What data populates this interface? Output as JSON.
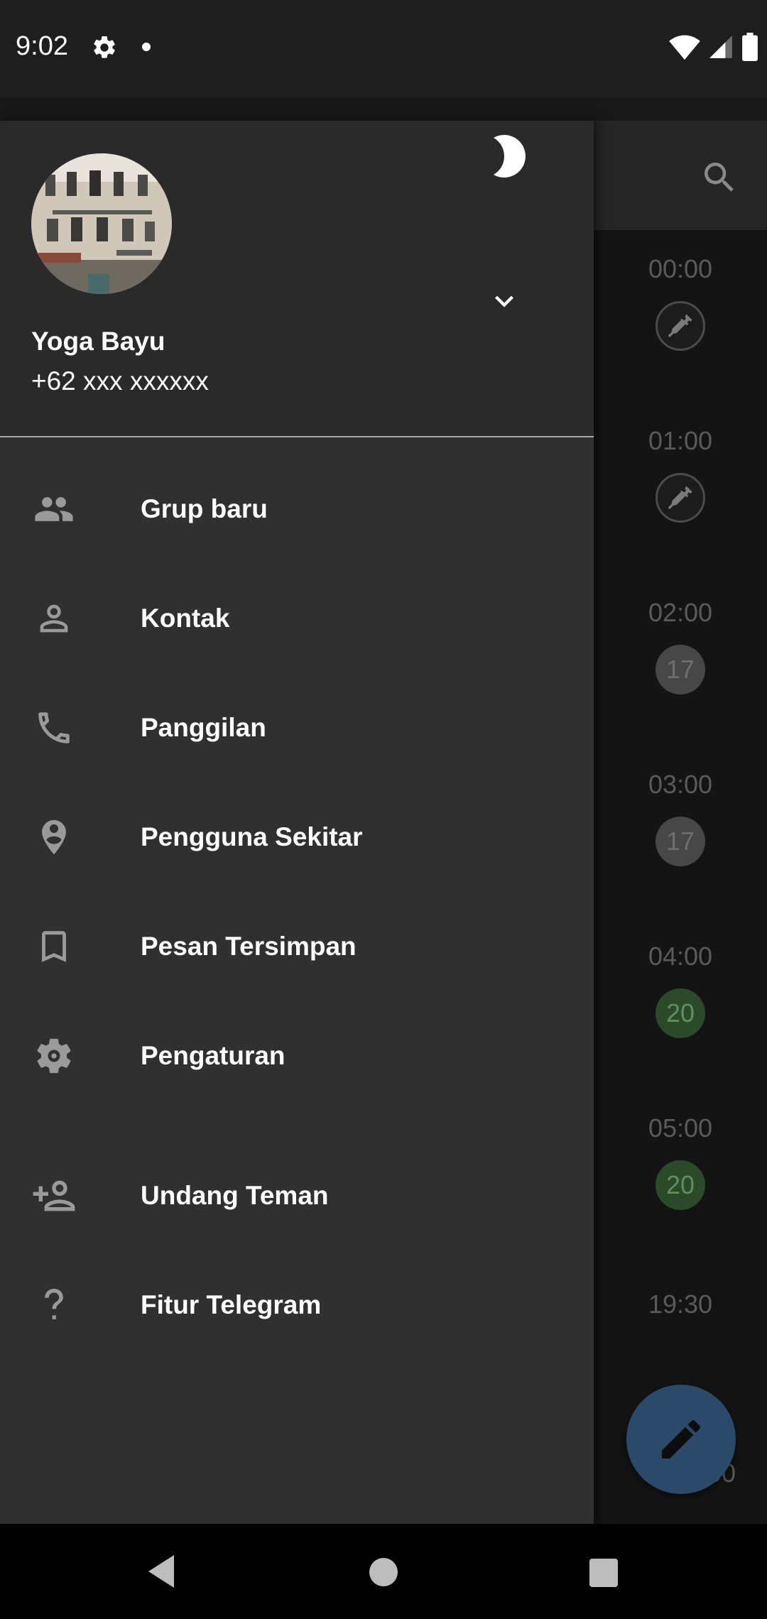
{
  "status_bar": {
    "time": "9:02"
  },
  "chat_list": {
    "items": [
      {
        "time": "00:00",
        "badge": "",
        "badge_type": "pin"
      },
      {
        "time": "01:00",
        "badge": "",
        "badge_type": "pin"
      },
      {
        "time": "02:00",
        "badge": "17",
        "badge_type": "grey"
      },
      {
        "time": "03:00",
        "badge": "17",
        "badge_type": "grey"
      },
      {
        "time": "04:00",
        "badge": "20",
        "badge_type": "green"
      },
      {
        "time": "05:00",
        "badge": "20",
        "badge_type": "green"
      },
      {
        "time": "19:30",
        "badge": "",
        "badge_type": "none"
      },
      {
        "time": "00",
        "badge": "",
        "badge_type": "none"
      }
    ]
  },
  "drawer": {
    "user": {
      "name": "Yoga Bayu",
      "phone": "+62 xxx xxxxxx"
    },
    "menu": [
      {
        "label": "Grup baru",
        "icon": "group-icon"
      },
      {
        "label": "Kontak",
        "icon": "person-icon"
      },
      {
        "label": "Panggilan",
        "icon": "phone-icon"
      },
      {
        "label": "Pengguna Sekitar",
        "icon": "location-person-icon"
      },
      {
        "label": "Pesan Tersimpan",
        "icon": "bookmark-icon"
      },
      {
        "label": "Pengaturan",
        "icon": "settings-icon"
      },
      {
        "label": "Undang Teman",
        "icon": "add-person-icon"
      },
      {
        "label": "Fitur Telegram",
        "icon": "help-icon"
      }
    ]
  },
  "colors": {
    "drawer_bg": "#303030",
    "header_bg": "#2a2a2a",
    "fab": "#2b4a6a",
    "badge_green": "#2a4a2a"
  }
}
